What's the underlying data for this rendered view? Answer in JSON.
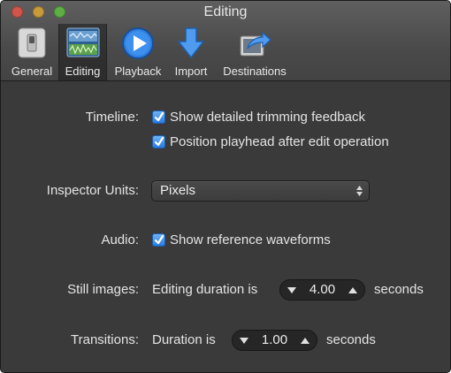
{
  "window": {
    "title": "Editing"
  },
  "toolbar": {
    "tabs": [
      {
        "label": "General",
        "icon": "switch-icon"
      },
      {
        "label": "Editing",
        "icon": "editing-icon",
        "selected": true
      },
      {
        "label": "Playback",
        "icon": "play-icon"
      },
      {
        "label": "Import",
        "icon": "download-arrow-icon"
      },
      {
        "label": "Destinations",
        "icon": "share-icon"
      }
    ]
  },
  "timeline": {
    "label": "Timeline:",
    "option1": "Show detailed trimming feedback",
    "option1_checked": true,
    "option2": "Position playhead after edit operation",
    "option2_checked": true
  },
  "inspector_units": {
    "label": "Inspector Units:",
    "value": "Pixels"
  },
  "audio": {
    "label": "Audio:",
    "option": "Show reference waveforms",
    "option_checked": true
  },
  "still_images": {
    "label": "Still images:",
    "prefix": "Editing duration is",
    "value": "4.00",
    "suffix": "seconds"
  },
  "transitions": {
    "label": "Transitions:",
    "prefix": "Duration is",
    "value": "1.00",
    "suffix": "seconds"
  },
  "colors": {
    "background": "#3a3a3a",
    "checkbox": "#2a7be0",
    "text": "#e4e4e4"
  }
}
